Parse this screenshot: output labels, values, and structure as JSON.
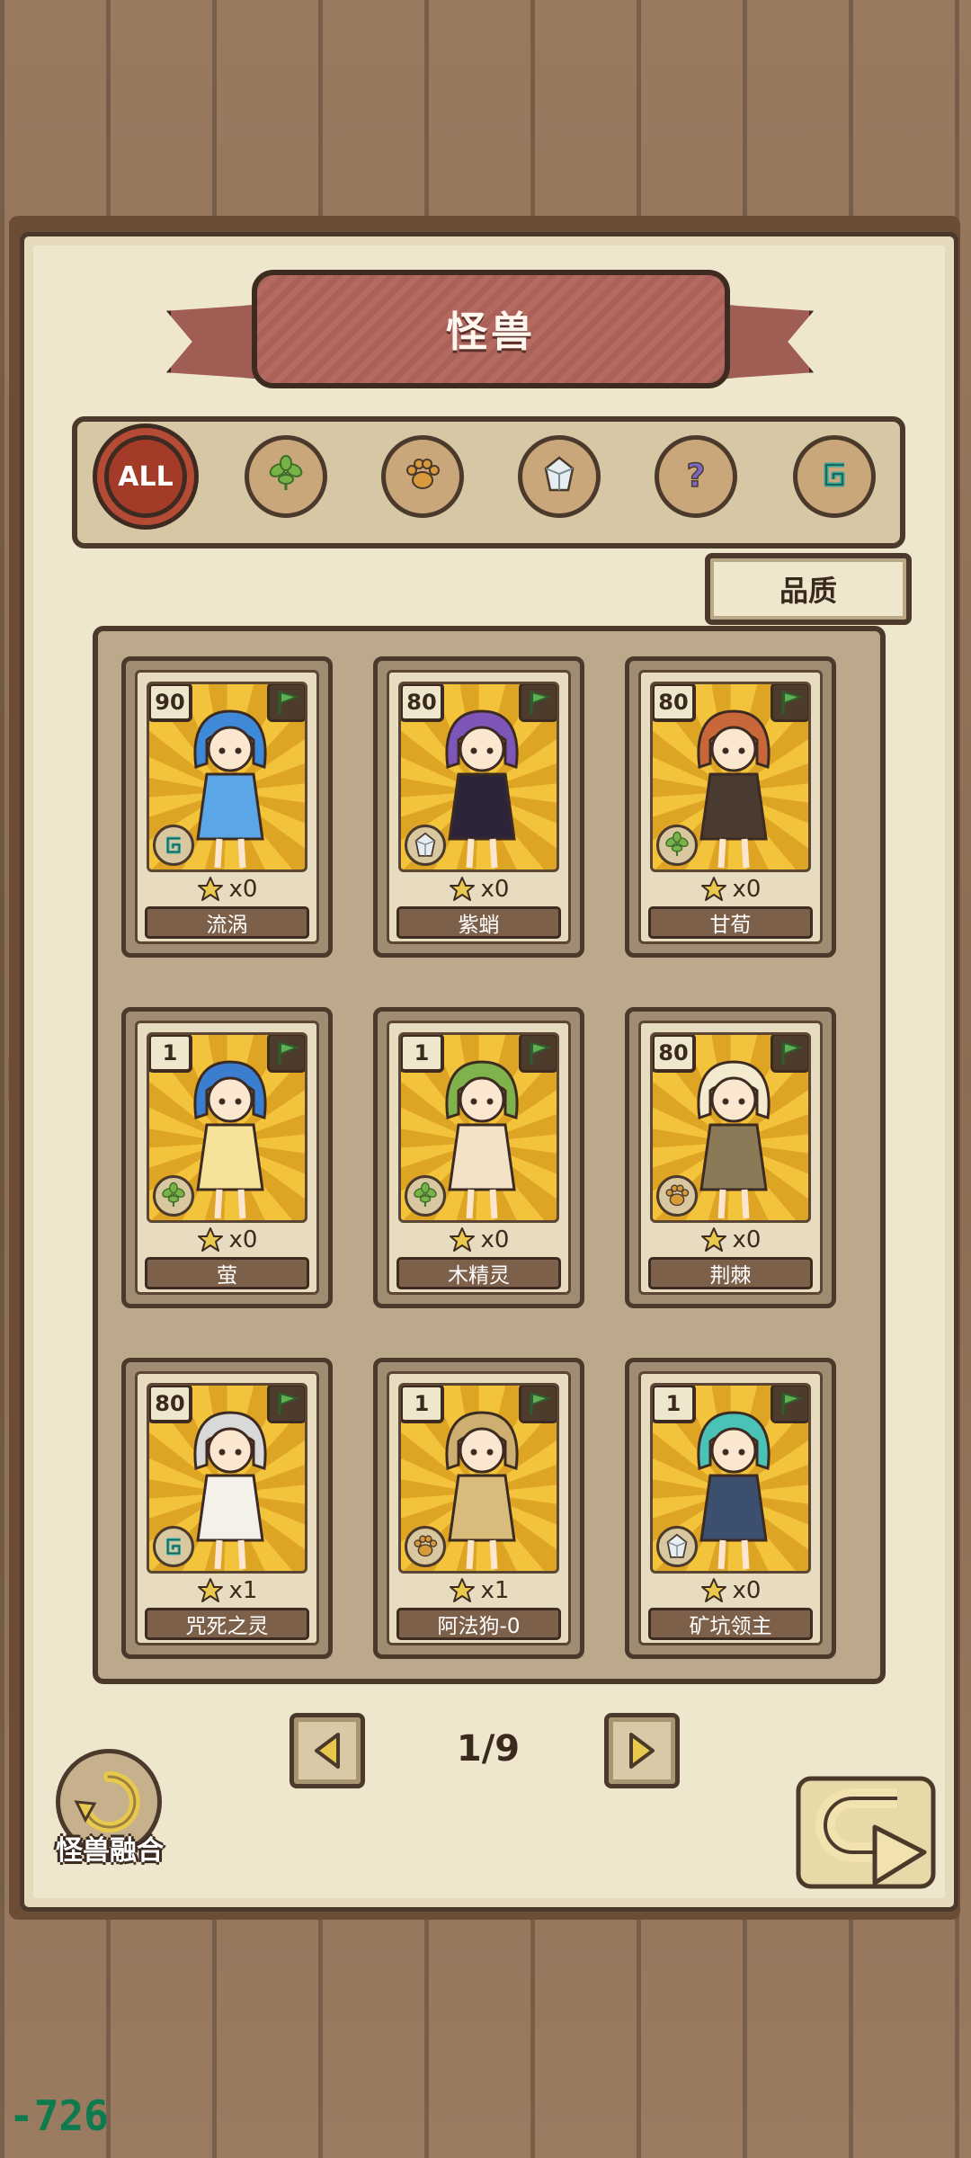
{
  "header": {
    "title": "怪兽"
  },
  "filters": [
    {
      "label": "ALL",
      "icon": "all-icon",
      "active": true
    },
    {
      "label": "",
      "icon": "leaf-icon",
      "active": false
    },
    {
      "label": "",
      "icon": "paw-icon",
      "active": false
    },
    {
      "label": "",
      "icon": "crystal-icon",
      "active": false
    },
    {
      "label": "",
      "icon": "question-icon",
      "active": false
    },
    {
      "label": "",
      "icon": "spiral-icon",
      "active": false
    }
  ],
  "sort": {
    "label": "品质"
  },
  "cards": [
    {
      "level": "90",
      "count": "x0",
      "name": "流涡",
      "type": "spiral-icon",
      "body": "#5aa6e6",
      "hair": "#3f8ad8"
    },
    {
      "level": "80",
      "count": "x0",
      "name": "紫蛸",
      "type": "crystal-icon",
      "body": "#2c2438",
      "hair": "#7e56b8"
    },
    {
      "level": "80",
      "count": "x0",
      "name": "甘荀",
      "type": "leaf-icon",
      "body": "#4a3b30",
      "hair": "#c8683a"
    },
    {
      "level": "1",
      "count": "x0",
      "name": "萤",
      "type": "leaf-icon",
      "body": "#f6e39a",
      "hair": "#3b7ed0"
    },
    {
      "level": "1",
      "count": "x0",
      "name": "木精灵",
      "type": "leaf-icon",
      "body": "#f4e2c8",
      "hair": "#7fb24a"
    },
    {
      "level": "80",
      "count": "x0",
      "name": "荆棘",
      "type": "paw-icon",
      "body": "#8a7a58",
      "hair": "#f3ead0"
    },
    {
      "level": "80",
      "count": "x1",
      "name": "咒死之灵",
      "type": "spiral-icon",
      "body": "#f4f1ea",
      "hair": "#d9d9d9"
    },
    {
      "level": "1",
      "count": "x1",
      "name": "阿法狗-0",
      "type": "paw-icon",
      "body": "#d9bb7c",
      "hair": "#cfae72"
    },
    {
      "level": "1",
      "count": "x0",
      "name": "矿坑领主",
      "type": "crystal-icon",
      "body": "#3d4f6e",
      "hair": "#49c3b6"
    }
  ],
  "pagination": {
    "current_page": 1,
    "total_pages": 9,
    "label": "1/9"
  },
  "fusion": {
    "label": "怪兽融合"
  },
  "debug": {
    "value": "-726"
  },
  "colors": {
    "accent": "#a33b28",
    "ribbon": "#b46a60",
    "flag": "#4d9a4a",
    "gold": "#f2c33b"
  }
}
